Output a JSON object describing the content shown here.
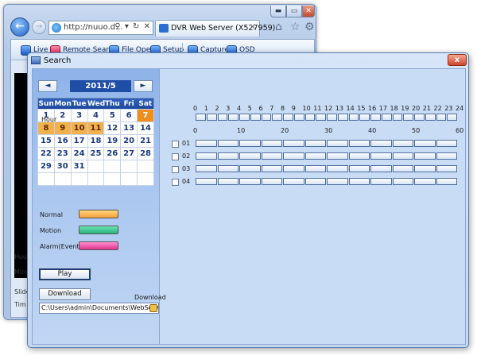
{
  "ie": {
    "address": "http://nuuo.d...",
    "address_icons": "⚲ ▾ ↻ ✕",
    "tab_label": "DVR Web Server (X527959)",
    "controls": {
      "minimize": "▬",
      "maximize": "▭",
      "close": "✕"
    }
  },
  "toolbar": {
    "items": [
      {
        "label": "Live",
        "icon": "live-icon"
      },
      {
        "label": "Remote Search",
        "icon": "remote-search-icon"
      },
      {
        "label": "File Open",
        "icon": "file-open-icon"
      },
      {
        "label": "Setup",
        "icon": "setup-icon"
      },
      {
        "label": "Capture",
        "icon": "capture-icon"
      },
      {
        "label": "OSD",
        "icon": "osd-icon"
      }
    ]
  },
  "side_labels": [
    "Hou",
    "Minu",
    "Slide",
    "Tim"
  ],
  "search": {
    "title": "Search",
    "close": "x",
    "calendar": {
      "prev": "◄",
      "next": "►",
      "month": "2011/5",
      "weekdays": [
        "Sun",
        "Mon",
        "Tue",
        "Wed",
        "Thu",
        "Fri",
        "Sat"
      ],
      "weeks": [
        [
          "1",
          "2",
          "3",
          "4",
          "5",
          "6",
          "7"
        ],
        [
          "8",
          "9",
          "10",
          "11",
          "12",
          "13",
          "14"
        ],
        [
          "15",
          "16",
          "17",
          "18",
          "19",
          "20",
          "21"
        ],
        [
          "22",
          "23",
          "24",
          "25",
          "26",
          "27",
          "28"
        ],
        [
          "29",
          "30",
          "31",
          "",
          "",
          "",
          ""
        ],
        [
          "",
          "",
          "",
          "",
          "",
          "",
          ""
        ]
      ],
      "days_with_recordings": [
        "7",
        "8",
        "9",
        "10",
        "11"
      ],
      "selected_day": "7"
    },
    "legend": {
      "normal": "Normal",
      "motion": "Motion",
      "alarm": "Alarm(Event)"
    },
    "play": "Play",
    "download": "Download",
    "download_label": "Download",
    "download_path": "C:\\Users\\admin\\Documents\\WebServer\\D",
    "timeline": {
      "hour_title": "Hour",
      "hour_ticks": [
        "0",
        "1",
        "2",
        "3",
        "4",
        "5",
        "6",
        "7",
        "8",
        "9",
        "10",
        "11",
        "12",
        "13",
        "14",
        "15",
        "16",
        "17",
        "18",
        "19",
        "20",
        "21",
        "22",
        "23",
        "24"
      ],
      "minute_ticks": [
        "0",
        "10",
        "20",
        "30",
        "40",
        "50",
        "60"
      ],
      "channels": [
        "01",
        "02",
        "03",
        "04"
      ]
    }
  },
  "colors": {
    "normal": "#f3a03a",
    "motion": "#25b37c",
    "alarm": "#e0348f",
    "selected_day": "#f08e1c",
    "accent": "#1f4ea6"
  }
}
